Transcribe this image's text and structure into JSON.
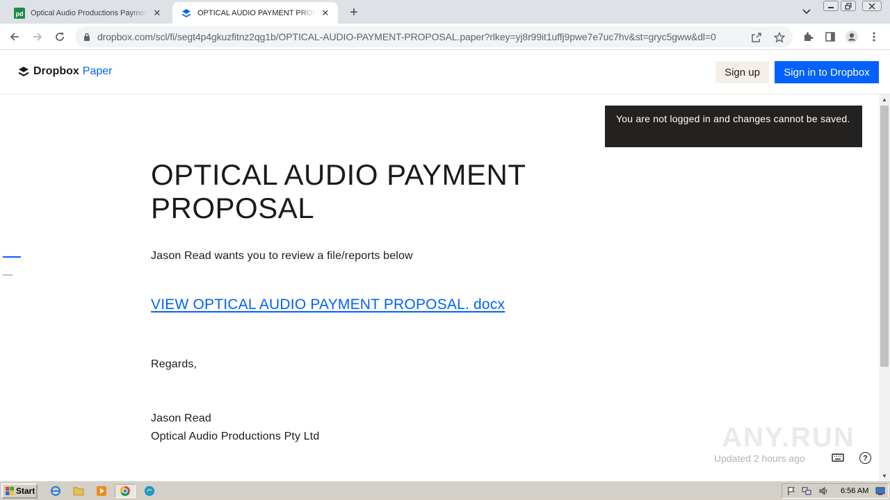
{
  "browser": {
    "tabs": [
      {
        "title": "Optical Audio Productions Payment Proposal",
        "icon": "pd-favicon-icon",
        "active": false
      },
      {
        "title": "OPTICAL AUDIO PAYMENT PROPOSAL",
        "icon": "dropbox-favicon-icon",
        "active": true
      }
    ],
    "url": "dropbox.com/scl/fi/segt4p4gkuzfitnz2qg1b/OPTICAL-AUDIO-PAYMENT-PROPOSAL.paper?rlkey=yj8r99it1uffj9pwe7e7uc7hv&st=gryc5gww&dl=0",
    "tab_close_glyph": "✕",
    "new_tab_glyph": "+"
  },
  "app": {
    "brand": "Dropbox",
    "product": "Paper",
    "signup_label": "Sign up",
    "signin_label": "Sign in to Dropbox",
    "accent_color": "#0061fe"
  },
  "document": {
    "notice": "You are not logged in and changes cannot be saved.",
    "title": "OPTICAL AUDIO PAYMENT PROPOSAL",
    "intro": "Jason Read wants you to review a file/reports below",
    "link_text": "VIEW OPTICAL AUDIO PAYMENT PROPOSAL. docx",
    "regards": "Regards,",
    "sender_name": "Jason Read",
    "sender_company": "Optical Audio Productions Pty Ltd",
    "updated": "Updated 2 hours ago",
    "help_glyph": "?"
  },
  "watermark": "ANY.RUN",
  "taskbar": {
    "start_label": "Start",
    "clock": "6:56 AM"
  }
}
